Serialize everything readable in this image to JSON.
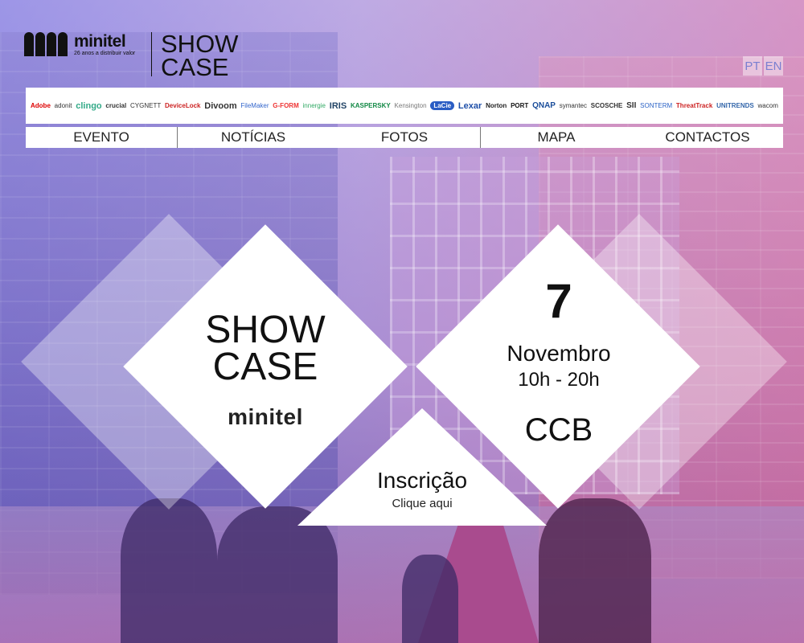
{
  "header": {
    "logo_name": "minitel",
    "logo_tagline": "26 anos a distribuir valor",
    "title_line1": "SHOW",
    "title_line2": "CASE"
  },
  "languages": [
    "PT",
    "EN"
  ],
  "brands": [
    "Adobe",
    "adonit",
    "clingo",
    "crucial",
    "CYGNETT",
    "DeviceLock",
    "Divoom",
    "FileMaker",
    "G-FORM",
    "innergie",
    "IRIS",
    "KASPERSKY",
    "Kensington",
    "LaCie",
    "Lexar",
    "Norton",
    "PORT",
    "QNAP",
    "symantec",
    "SCOSCHE",
    "SII",
    "SONTERM",
    "ThreatTrack",
    "UNITRENDS",
    "wacom"
  ],
  "nav": {
    "items": [
      "EVENTO",
      "NOTÍCIAS",
      "FOTOS",
      "MAPA",
      "CONTACTOS"
    ]
  },
  "showcase": {
    "title_line1": "SHOW",
    "title_line2": "CASE",
    "brand": "minitel"
  },
  "event": {
    "day": "7",
    "month": "Novembro",
    "hours": "10h - 20h",
    "venue": "CCB"
  },
  "registration": {
    "title": "Inscrição",
    "subtitle": "Clique aqui"
  },
  "colors": {
    "overlay_left": "#7a6ee6",
    "overlay_right": "#e16eaa",
    "lang_text": "#7a7fd0"
  }
}
